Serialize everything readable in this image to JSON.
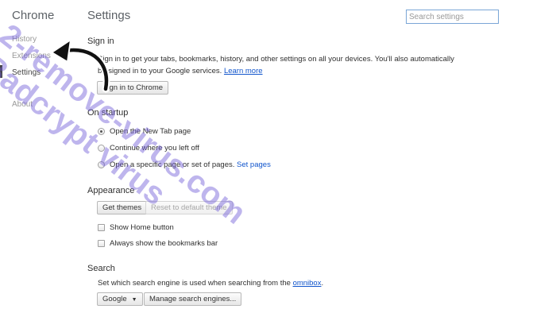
{
  "sidebar": {
    "title": "Chrome",
    "items": [
      {
        "label": "History"
      },
      {
        "label": "Extensions"
      },
      {
        "label": "Settings"
      },
      {
        "label": "About"
      }
    ]
  },
  "header": {
    "title": "Settings",
    "search_placeholder": "Search settings"
  },
  "sign_in": {
    "title": "Sign in",
    "description_line1": "Sign in to get your tabs, bookmarks, history, and other settings on all your devices. You'll also automatically",
    "description_line2": "be signed in to your Google services.",
    "learn_more": "Learn more",
    "button": "Sign in to Chrome"
  },
  "on_startup": {
    "title": "On startup",
    "options": [
      {
        "label": "Open the New Tab page",
        "checked": true
      },
      {
        "label": "Continue where you left off",
        "checked": false
      },
      {
        "label": "Open a specific page or set of pages.",
        "checked": false
      }
    ],
    "set_pages": "Set pages"
  },
  "appearance": {
    "title": "Appearance",
    "get_themes": "Get themes",
    "reset_theme": "Reset to default theme",
    "show_home_button": "Show Home button",
    "show_bookmarks_bar": "Always show the bookmarks bar"
  },
  "search": {
    "title": "Search",
    "description": "Set which search engine is used when searching from the",
    "omnibox": "omnibox",
    "period": ".",
    "engine": "Google",
    "manage": "Manage search engines..."
  },
  "watermarks": {
    "line1": "2-remove-virus.com",
    "line2": "Badcrypt virus"
  },
  "colors": {
    "link": "#1155cc",
    "watermark": "#6e5ad7"
  }
}
